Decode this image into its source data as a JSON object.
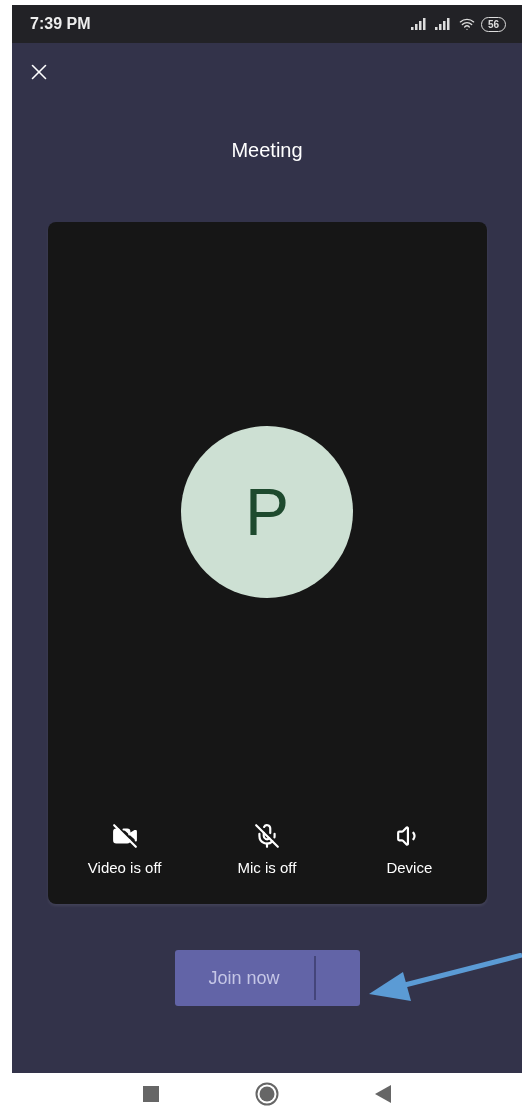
{
  "status_bar": {
    "time": "7:39 PM",
    "battery": "56"
  },
  "title": "Meeting",
  "avatar": {
    "initial": "P"
  },
  "controls": [
    {
      "kind": "video",
      "label": "Video is off",
      "on": false
    },
    {
      "kind": "mic",
      "label": "Mic is off",
      "on": false
    },
    {
      "kind": "speaker",
      "label": "Device"
    }
  ],
  "join_button": {
    "label": "Join now"
  }
}
